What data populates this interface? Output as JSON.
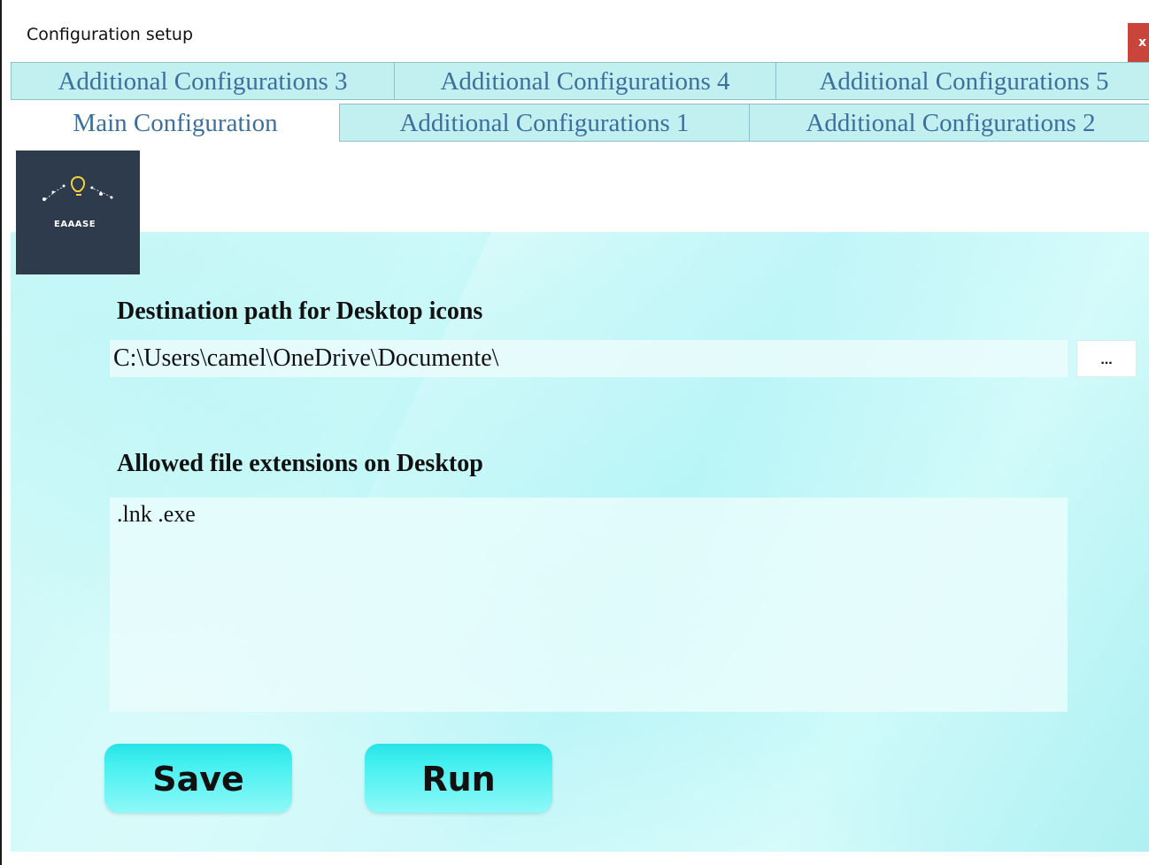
{
  "window": {
    "title": "Configuration setup",
    "close_label": "x"
  },
  "tabs": {
    "row_top": [
      {
        "label": "Additional Configurations 3"
      },
      {
        "label": "Additional Configurations 4"
      },
      {
        "label": "Additional Configurations 5"
      }
    ],
    "row_bottom": [
      {
        "label": "Main Configuration",
        "active": true
      },
      {
        "label": "Additional Configurations 1"
      },
      {
        "label": "Additional Configurations 2"
      }
    ]
  },
  "logo": {
    "text": "EAAASE",
    "icon": "lightbulb-icon"
  },
  "main": {
    "destination_label": "Destination path for Desktop icons",
    "destination_value": "C:\\Users\\camel\\OneDrive\\Documente\\",
    "browse_label": "...",
    "extensions_label": "Allowed file extensions on Desktop",
    "extensions_value": ".lnk .exe",
    "save_label": "Save",
    "run_label": "Run"
  },
  "colors": {
    "tab_background": "#c2eff0",
    "tab_text": "#3d6f9e",
    "panel_background": "#b2f4f6",
    "button_accent": "#26e3e6",
    "logo_background": "#2d3b4d",
    "close_button": "#c9443b"
  }
}
